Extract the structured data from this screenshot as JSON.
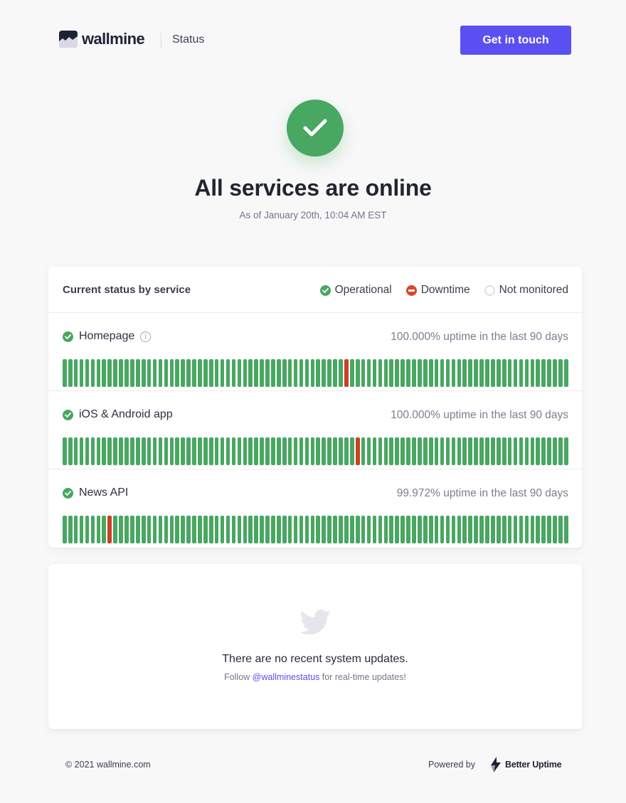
{
  "header": {
    "logo_text": "wallmine",
    "section_label": "Status",
    "cta_label": "Get in touch"
  },
  "hero": {
    "title": "All services are online",
    "subtitle": "As of January 20th, 10:04 AM EST"
  },
  "status_card": {
    "title": "Current status by service",
    "legend": [
      {
        "label": "Operational",
        "icon": "check-circle-icon",
        "color": "#48a761"
      },
      {
        "label": "Downtime",
        "icon": "minus-circle-icon",
        "color": "#d4492f"
      },
      {
        "label": "Not monitored",
        "icon": "empty-circle-icon",
        "color": "#dfe0e4"
      }
    ],
    "services": [
      {
        "name": "Homepage",
        "has_info": true,
        "uptime": "100.000% uptime in the last 90 days",
        "days": 90,
        "down_days": [
          50
        ]
      },
      {
        "name": "iOS & Android app",
        "has_info": false,
        "uptime": "100.000% uptime in the last 90 days",
        "days": 90,
        "down_days": [
          52
        ]
      },
      {
        "name": "News API",
        "has_info": false,
        "uptime": "99.972% uptime in the last 90 days",
        "days": 90,
        "down_days": [
          8
        ]
      }
    ]
  },
  "updates": {
    "icon": "twitter-icon",
    "message": "There are no recent system updates.",
    "follow_prefix": "Follow ",
    "follow_handle": "@wallminestatus",
    "follow_suffix": " for real-time updates!"
  },
  "footer": {
    "copyright": "© 2021 wallmine.com",
    "powered_by": "Powered by",
    "brand": "Better Uptime"
  },
  "colors": {
    "accent": "#5a4ff0",
    "operational": "#48a761",
    "downtime": "#c94126"
  }
}
